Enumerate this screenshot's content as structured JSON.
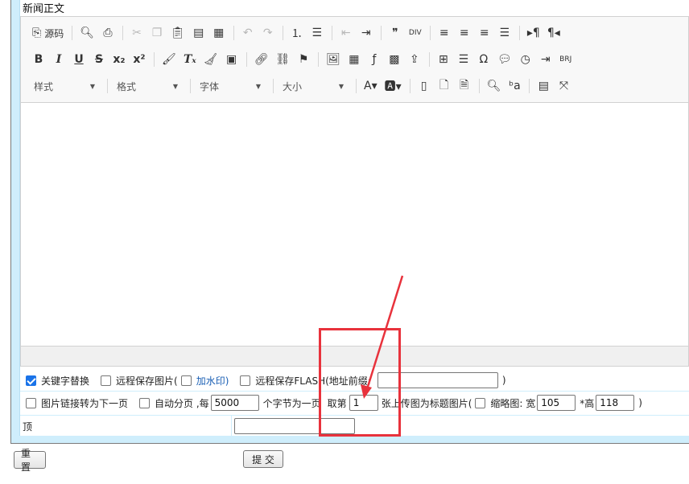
{
  "title": "新闻正文",
  "toolbar": {
    "row1": [
      {
        "name": "source-button",
        "icon": "⎘",
        "label": "源码"
      },
      {
        "sep": true
      },
      {
        "name": "preview-button",
        "icon": "🔍︎"
      },
      {
        "name": "print-button",
        "icon": "⎙"
      },
      {
        "sep": true
      },
      {
        "name": "cut-button",
        "icon": "✂",
        "dim": true
      },
      {
        "name": "copy-button",
        "icon": "❐",
        "dim": true
      },
      {
        "name": "paste-button",
        "icon": "📋︎"
      },
      {
        "name": "paste-text-button",
        "icon": "▤"
      },
      {
        "name": "paste-word-button",
        "icon": "▦"
      },
      {
        "sep": true
      },
      {
        "name": "undo-button",
        "icon": "↶",
        "dim": true
      },
      {
        "name": "redo-button",
        "icon": "↷",
        "dim": true
      },
      {
        "sep": true
      },
      {
        "name": "numbered-list-button",
        "icon": "⒈"
      },
      {
        "name": "bulleted-list-button",
        "icon": "☰"
      },
      {
        "sep": true
      },
      {
        "name": "outdent-button",
        "icon": "⇤",
        "dim": true
      },
      {
        "name": "indent-button",
        "icon": "⇥"
      },
      {
        "sep": true
      },
      {
        "name": "blockquote-button",
        "icon": "❞"
      },
      {
        "name": "div-button",
        "icon": "DIV"
      },
      {
        "sep": true
      },
      {
        "name": "align-left-button",
        "icon": "≡"
      },
      {
        "name": "align-center-button",
        "icon": "≡"
      },
      {
        "name": "align-right-button",
        "icon": "≡"
      },
      {
        "name": "justify-button",
        "icon": "☰"
      },
      {
        "sep": true
      },
      {
        "name": "ltr-button",
        "icon": "▸¶"
      },
      {
        "name": "rtl-button",
        "icon": "¶◂"
      }
    ],
    "row2": [
      {
        "name": "bold-button",
        "icon": "B",
        "cls": "bold"
      },
      {
        "name": "italic-button",
        "icon": "I",
        "cls": "it"
      },
      {
        "name": "underline-button",
        "icon": "U",
        "cls": "ul"
      },
      {
        "name": "strike-button",
        "icon": "S",
        "cls": "st"
      },
      {
        "name": "subscript-button",
        "icon": "x₂",
        "cls": "bold"
      },
      {
        "name": "superscript-button",
        "icon": "x²",
        "cls": "bold"
      },
      {
        "sep": true
      },
      {
        "name": "format-painter-button",
        "icon": "🖌︎"
      },
      {
        "name": "remove-format-button",
        "icon": "Tₓ",
        "cls": "it"
      },
      {
        "name": "clean-button",
        "icon": "🧹︎"
      },
      {
        "name": "paste-from-word-button",
        "icon": "▣"
      },
      {
        "sep": true
      },
      {
        "name": "link-button",
        "icon": "🔗︎"
      },
      {
        "name": "unlink-button",
        "icon": "⛓"
      },
      {
        "name": "anchor-button",
        "icon": "⚑"
      },
      {
        "sep": true
      },
      {
        "name": "image-button",
        "icon": "🖼︎"
      },
      {
        "name": "table-insert-button",
        "icon": "▦"
      },
      {
        "name": "flash-button",
        "icon": "ƒ"
      },
      {
        "name": "media-button",
        "icon": "▩"
      },
      {
        "name": "upload-button",
        "icon": "⇪"
      },
      {
        "sep": true
      },
      {
        "name": "table-button",
        "icon": "⊞"
      },
      {
        "name": "hr-button",
        "icon": "☰"
      },
      {
        "name": "special-char-button",
        "icon": "Ω"
      },
      {
        "name": "smiley-button",
        "icon": "💬︎"
      },
      {
        "name": "time-button",
        "icon": "◷"
      },
      {
        "name": "pagebreak-button",
        "icon": "⇥"
      },
      {
        "name": "brj-button",
        "icon": "BRJ"
      }
    ],
    "row3_combos": [
      {
        "name": "style-select",
        "label": "样式",
        "w": 88
      },
      {
        "name": "format-select",
        "label": "格式",
        "w": 88
      },
      {
        "name": "font-select",
        "label": "字体",
        "w": 88
      },
      {
        "name": "size-select",
        "label": "大小",
        "w": 88
      }
    ],
    "row3": [
      {
        "name": "text-color-button",
        "icon": "A▾"
      },
      {
        "name": "bg-color-button",
        "icon": "🅰▾"
      },
      {
        "sep": true
      },
      {
        "name": "maximize-doc-button",
        "icon": "▯"
      },
      {
        "name": "new-page-button",
        "icon": "🗋︎"
      },
      {
        "name": "template-button",
        "icon": "🗎︎"
      },
      {
        "sep": true
      },
      {
        "name": "find-button",
        "icon": "🔍︎"
      },
      {
        "name": "replace-button",
        "icon": "ᵇa"
      },
      {
        "sep": true
      },
      {
        "name": "show-blocks-button",
        "icon": "▤"
      },
      {
        "name": "fullscreen-button",
        "icon": "⤧"
      }
    ]
  },
  "options": {
    "keyword_replace": "关键字替换",
    "remote_save_images": "远程保存图片(",
    "watermark": "加水印)",
    "remote_save_flash": "远程保存FLASH(地址前缀:",
    "flash_prefix_value": "",
    "close_paren": ")",
    "image_link_next": "图片链接转为下一页",
    "auto_paging": "自动分页 ,每",
    "chars_per_page": "5000",
    "chars_suffix": "个字节为一页",
    "take_nth": "取第",
    "nth_value": "1",
    "as_title_image": "张上传图为标题图片(",
    "thumbnail_width_label": "缩略图: 宽",
    "thumbnail_width": "105",
    "height_label": "*高",
    "thumbnail_height": "118",
    "end_paren": ")"
  },
  "page_row": {
    "label": "顶",
    "value": ""
  },
  "buttons": {
    "reset": "重置",
    "submit": "提 交"
  },
  "annotation": {
    "color": "#e8323c"
  }
}
